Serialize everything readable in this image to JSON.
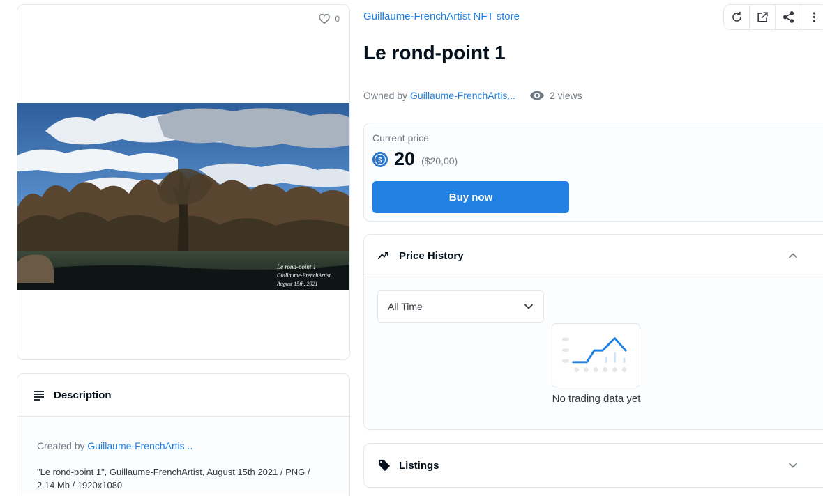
{
  "media": {
    "favorite_count": "0",
    "artwork_caption": [
      "Le rond-point 1",
      "Guillaume-FrenchArtist",
      "August 15th, 2021"
    ]
  },
  "description": {
    "title": "Description",
    "created_by_prefix": "Created by",
    "creator": "Guillaume-FrenchArtis...",
    "text": "\"Le rond-point 1\", Guillaume-FrenchArtist, August 15th 2021 / PNG / 2.14 Mb / 1920x1080"
  },
  "collection": {
    "name": "Guillaume-FrenchArtist NFT store"
  },
  "toolbar": {
    "buttons": [
      "refresh-icon",
      "external-link-icon",
      "share-icon",
      "more-vertical-icon"
    ]
  },
  "item": {
    "title": "Le rond-point 1",
    "owned_by_prefix": "Owned by",
    "owner": "Guillaume-FrenchArtis...",
    "views": "2 views"
  },
  "price": {
    "label": "Current price",
    "amount": "20",
    "fiat": "($20,00)",
    "buy_label": "Buy now"
  },
  "price_history": {
    "title": "Price History",
    "filter_value": "All Time",
    "empty_text": "No trading data yet"
  },
  "listings": {
    "title": "Listings"
  },
  "colors": {
    "accent": "#2081e2",
    "text_dark": "#04111d",
    "text_muted": "#707a83",
    "border": "#e5e8eb"
  }
}
